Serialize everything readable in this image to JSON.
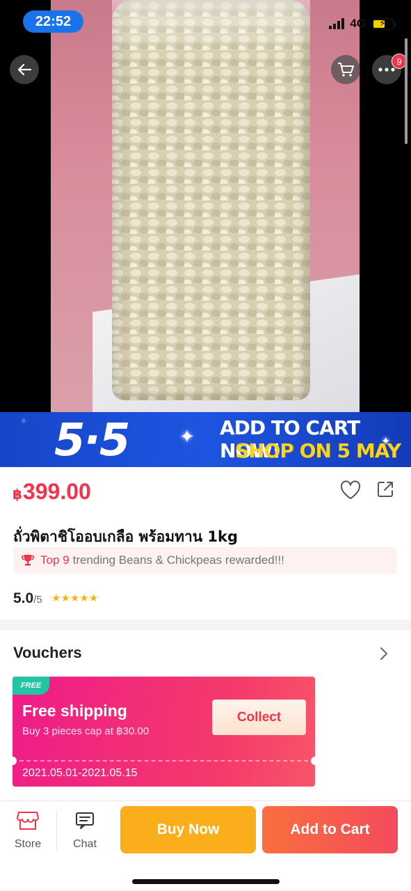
{
  "status_bar": {
    "time": "22:52",
    "network": "4G"
  },
  "top_nav": {
    "cart_badge": "9"
  },
  "banner": {
    "big_text": "5·5",
    "line1": "ADD TO CART NOW!",
    "line2": "SHOP ON 5 MAY"
  },
  "product": {
    "currency": "฿",
    "price": "399.00",
    "title": "ถั่วพิตาชิโออบเกลือ พร้อมทาน 1kg",
    "trend_top": "Top 9",
    "trend_text": "trending Beans & Chickpeas  rewarded!!!",
    "rating": "5.0",
    "rating_max": "/5",
    "stars": "★★★★★"
  },
  "vouchers": {
    "title": "Vouchers",
    "card": {
      "tag": "FREE",
      "title": "Free shipping",
      "desc": "Buy 3 pieces cap at ฿30.00",
      "date": "2021.05.01-2021.05.15",
      "button": "Collect"
    }
  },
  "bottom_bar": {
    "store": "Store",
    "chat": "Chat",
    "buy_now": "Buy Now",
    "add_to_cart": "Add to Cart"
  },
  "colors": {
    "accent": "#f0344e",
    "buy_now": "#fbae1b",
    "banner": "#1d55e0",
    "voucher": "#ee1c8a"
  }
}
